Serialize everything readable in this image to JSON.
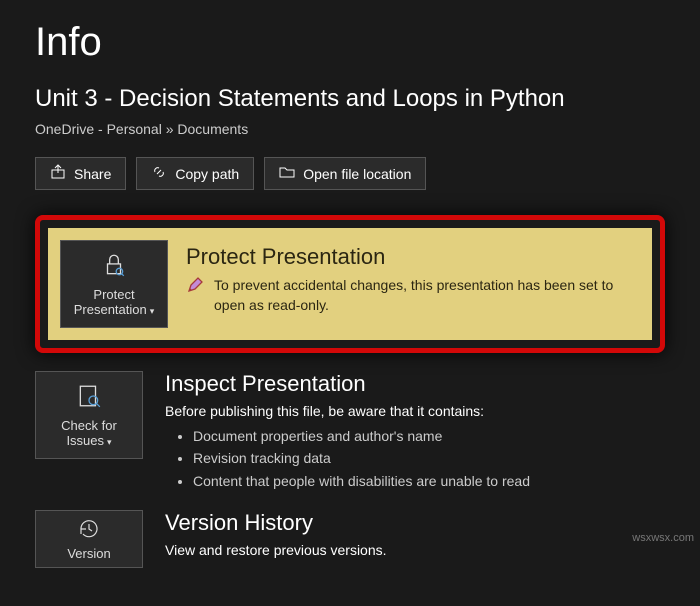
{
  "page": {
    "title": "Info",
    "doc_title": "Unit 3 - Decision Statements and Loops in Python",
    "breadcrumb": "OneDrive - Personal » Documents"
  },
  "actions": {
    "share": "Share",
    "copy_path": "Copy path",
    "open_location": "Open file location"
  },
  "protect": {
    "tile_line1": "Protect",
    "tile_line2": "Presentation",
    "heading": "Protect Presentation",
    "text": "To prevent accidental changes, this presentation has been set to open as read-only."
  },
  "inspect": {
    "tile_line1": "Check for",
    "tile_line2": "Issues",
    "heading": "Inspect Presentation",
    "intro": "Before publishing this file, be aware that it contains:",
    "items": [
      "Document properties and author's name",
      "Revision tracking data",
      "Content that people with disabilities are unable to read"
    ]
  },
  "history": {
    "tile_line1": "Version",
    "heading": "Version History",
    "text": "View and restore previous versions."
  },
  "watermark": "wsxwsx.com"
}
